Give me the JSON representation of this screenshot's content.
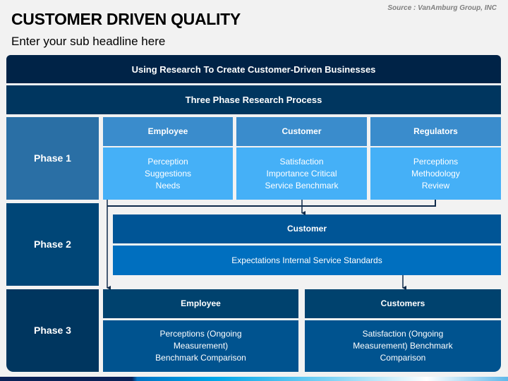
{
  "header": {
    "title": "CUSTOMER DRIVEN QUALITY",
    "subtitle": "Enter your sub headline here",
    "source": "Source : VanAmburg Group, INC"
  },
  "banners": {
    "main": "Using Research To Create Customer-Driven Businesses",
    "process": "Three Phase Research Process"
  },
  "phases": [
    {
      "label": "Phase 1",
      "columns": [
        {
          "heading": "Employee",
          "lines": [
            "Perception",
            "Suggestions",
            "Needs"
          ]
        },
        {
          "heading": "Customer",
          "lines": [
            "Satisfaction",
            "Importance Critical",
            "Service Benchmark"
          ]
        },
        {
          "heading": "Regulators",
          "lines": [
            "Perceptions",
            "Methodology",
            "Review"
          ]
        }
      ]
    },
    {
      "label": "Phase 2",
      "columns": [
        {
          "heading": "Customer",
          "lines": [
            "Expectations Internal Service Standards"
          ]
        }
      ]
    },
    {
      "label": "Phase 3",
      "columns": [
        {
          "heading": "Employee",
          "lines": [
            "Perceptions (Ongoing",
            "Measurement)",
            "Benchmark Comparison"
          ]
        },
        {
          "heading": "Customers",
          "lines": [
            "Satisfaction (Ongoing",
            "Measurement) Benchmark",
            "Comparison"
          ]
        }
      ]
    }
  ],
  "colors": {
    "dark_navy": "#002347",
    "phase1": "#2a6fa5",
    "light_blue": "#45b0f7",
    "mid_blue": "#3a8ccc",
    "connector": "#0f2a4a"
  }
}
